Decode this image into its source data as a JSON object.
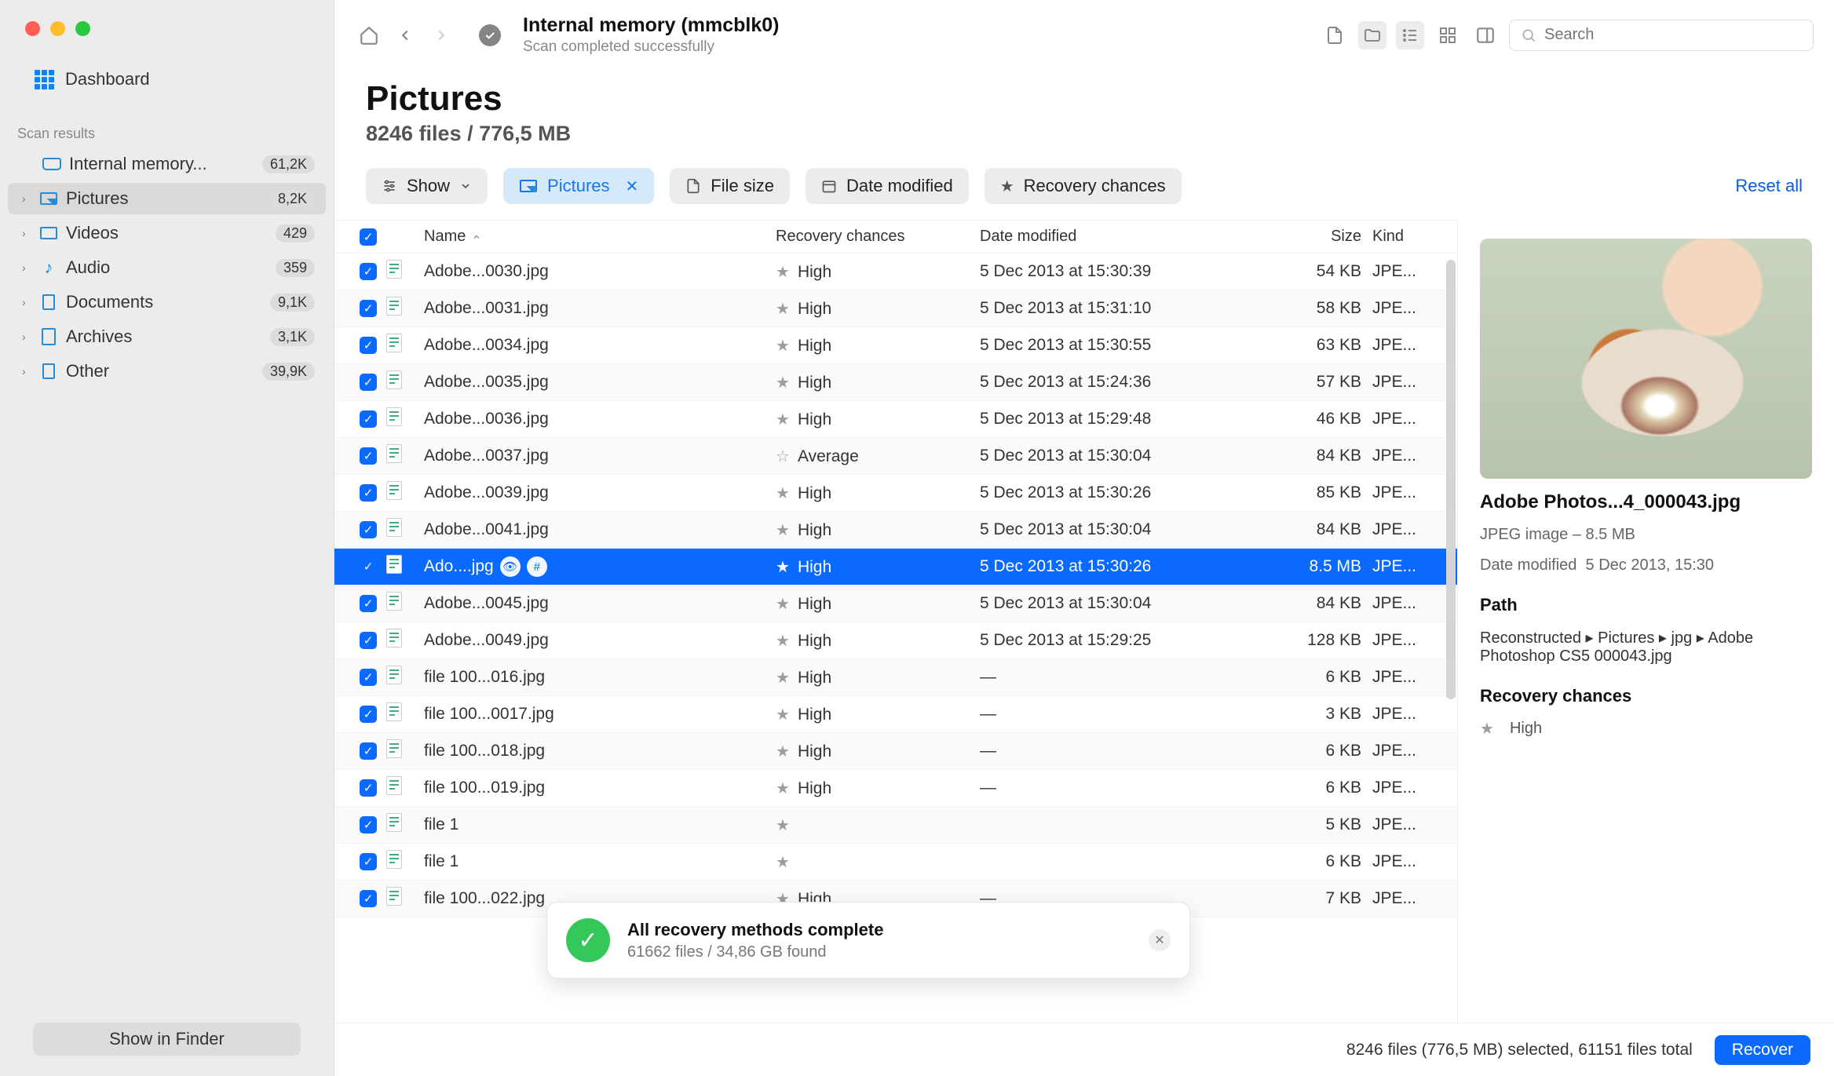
{
  "sidebar": {
    "dashboard_label": "Dashboard",
    "scan_results_label": "Scan results",
    "drive": {
      "label": "Internal memory...",
      "badge": "61,2K"
    },
    "items": [
      {
        "label": "Pictures",
        "badge": "8,2K"
      },
      {
        "label": "Videos",
        "badge": "429"
      },
      {
        "label": "Audio",
        "badge": "359"
      },
      {
        "label": "Documents",
        "badge": "9,1K"
      },
      {
        "label": "Archives",
        "badge": "3,1K"
      },
      {
        "label": "Other",
        "badge": "39,9K"
      }
    ],
    "show_in_finder": "Show in Finder"
  },
  "toolbar": {
    "title": "Internal memory (mmcblk0)",
    "subtitle": "Scan completed successfully",
    "search_placeholder": "Search"
  },
  "heading": {
    "title": "Pictures",
    "subtitle": "8246 files / 776,5 MB"
  },
  "filters": {
    "show_label": "Show",
    "pictures_label": "Pictures",
    "filesize_label": "File size",
    "date_label": "Date modified",
    "recovery_label": "Recovery chances",
    "reset_label": "Reset all"
  },
  "columns": {
    "name": "Name",
    "recovery": "Recovery chances",
    "date": "Date modified",
    "size": "Size",
    "kind": "Kind"
  },
  "rows": [
    {
      "name": "Adobe...0030.jpg",
      "rec": "High",
      "date": "5 Dec 2013 at 15:30:39",
      "size": "54 KB",
      "kind": "JPE..."
    },
    {
      "name": "Adobe...0031.jpg",
      "rec": "High",
      "date": "5 Dec 2013 at 15:31:10",
      "size": "58 KB",
      "kind": "JPE..."
    },
    {
      "name": "Adobe...0034.jpg",
      "rec": "High",
      "date": "5 Dec 2013 at 15:30:55",
      "size": "63 KB",
      "kind": "JPE..."
    },
    {
      "name": "Adobe...0035.jpg",
      "rec": "High",
      "date": "5 Dec 2013 at 15:24:36",
      "size": "57 KB",
      "kind": "JPE..."
    },
    {
      "name": "Adobe...0036.jpg",
      "rec": "High",
      "date": "5 Dec 2013 at 15:29:48",
      "size": "46 KB",
      "kind": "JPE..."
    },
    {
      "name": "Adobe...0037.jpg",
      "rec": "Average",
      "date": "5 Dec 2013 at 15:30:04",
      "size": "84 KB",
      "kind": "JPE..."
    },
    {
      "name": "Adobe...0039.jpg",
      "rec": "High",
      "date": "5 Dec 2013 at 15:30:26",
      "size": "85 KB",
      "kind": "JPE..."
    },
    {
      "name": "Adobe...0041.jpg",
      "rec": "High",
      "date": "5 Dec 2013 at 15:30:04",
      "size": "84 KB",
      "kind": "JPE..."
    },
    {
      "name": "Ado....jpg",
      "rec": "High",
      "date": "5 Dec 2013 at 15:30:26",
      "size": "8.5 MB",
      "kind": "JPE...",
      "selected": true
    },
    {
      "name": "Adobe...0045.jpg",
      "rec": "High",
      "date": "5 Dec 2013 at 15:30:04",
      "size": "84 KB",
      "kind": "JPE..."
    },
    {
      "name": "Adobe...0049.jpg",
      "rec": "High",
      "date": "5 Dec 2013 at 15:29:25",
      "size": "128 KB",
      "kind": "JPE..."
    },
    {
      "name": "file 100...016.jpg",
      "rec": "High",
      "date": "—",
      "size": "6 KB",
      "kind": "JPE..."
    },
    {
      "name": "file 100...0017.jpg",
      "rec": "High",
      "date": "—",
      "size": "3 KB",
      "kind": "JPE..."
    },
    {
      "name": "file 100...018.jpg",
      "rec": "High",
      "date": "—",
      "size": "6 KB",
      "kind": "JPE..."
    },
    {
      "name": "file 100...019.jpg",
      "rec": "High",
      "date": "—",
      "size": "6 KB",
      "kind": "JPE..."
    },
    {
      "name": "file 1",
      "rec": "",
      "date": "",
      "size": "5 KB",
      "kind": "JPE..."
    },
    {
      "name": "file 1",
      "rec": "",
      "date": "",
      "size": "6 KB",
      "kind": "JPE..."
    },
    {
      "name": "file 100...022.jpg",
      "rec": "High",
      "date": "—",
      "size": "7 KB",
      "kind": "JPE..."
    }
  ],
  "detail": {
    "filename": "Adobe Photos...4_000043.jpg",
    "meta": "JPEG image – 8.5 MB",
    "date_label": "Date modified",
    "date_value": "5 Dec 2013, 15:30",
    "path_label": "Path",
    "path_value": "Reconstructed ▸ Pictures ▸ jpg ▸ Adobe Photoshop CS5 000043.jpg",
    "rc_label": "Recovery chances",
    "rc_value": "High"
  },
  "footer": {
    "summary": "8246 files (776,5 MB) selected, 61151 files total",
    "recover_label": "Recover"
  },
  "toast": {
    "title": "All recovery methods complete",
    "subtitle": "61662 files / 34,86 GB found"
  }
}
